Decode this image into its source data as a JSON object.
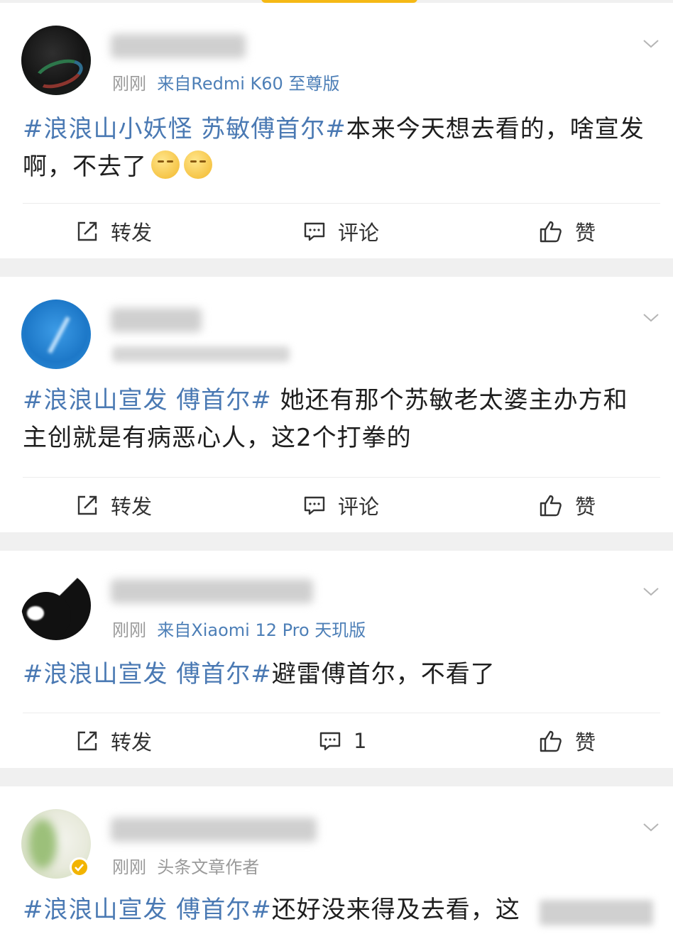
{
  "posts": [
    {
      "meta_prefix": "刚刚",
      "meta_source": "来自Redmi K60 至尊版",
      "hashtag": "#浪浪山小妖怪 苏敏傅首尔#",
      "text": "本来今天想去看的，啥宣发啊，不去了",
      "actions": {
        "repost": "转发",
        "comment": "评论",
        "like": "赞"
      }
    },
    {
      "hashtag": "#浪浪山宣发 傅首尔#",
      "text": " 她还有那个苏敏老太婆主办方和主创就是有病恶心人，这2个打拳的",
      "actions": {
        "repost": "转发",
        "comment": "评论",
        "like": "赞"
      }
    },
    {
      "meta_prefix": "刚刚",
      "meta_source": "来自Xiaomi 12 Pro 天玑版",
      "hashtag": "#浪浪山宣发 傅首尔#",
      "text": "避雷傅首尔，不看了",
      "actions": {
        "repost": "转发",
        "comment": "1",
        "like": "赞"
      }
    },
    {
      "meta_prefix": "刚刚",
      "meta_source": "头条文章作者",
      "hashtag": "#浪浪山宣发 傅首尔#",
      "text": "还好没来得及去看，这"
    }
  ],
  "icons": {
    "repost": "repost-icon",
    "comment": "comment-icon",
    "like": "thumbs-up-icon",
    "menu": "chevron-down-icon",
    "verified": "verified-badge-icon"
  },
  "colors": {
    "hashtag": "#4a79b3",
    "source": "#4d7fb7",
    "meta": "#9a9a9a",
    "separator": "#f0f0f0",
    "accent_bar": "#f5b915"
  }
}
